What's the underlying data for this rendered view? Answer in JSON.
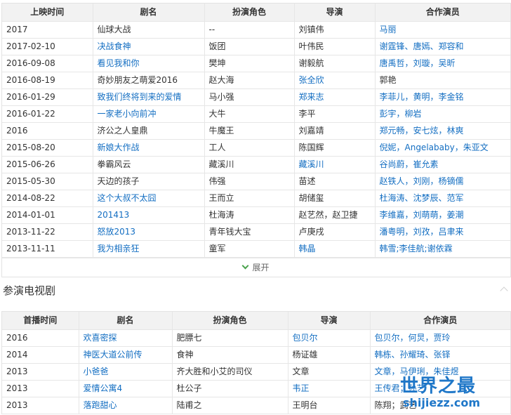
{
  "films": {
    "headers": [
      "上映时间",
      "剧名",
      "扮演角色",
      "导演",
      "合作演员"
    ],
    "rows": [
      {
        "date": "2017",
        "title": {
          "text": "仙球大战",
          "link": false
        },
        "role": "--",
        "director": {
          "text": "刘镇伟",
          "link": false
        },
        "costars": {
          "text": "马丽",
          "link": true
        }
      },
      {
        "date": "2017-02-10",
        "title": {
          "text": "决战食神",
          "link": true
        },
        "role": "饭团",
        "director": {
          "text": "叶伟民",
          "link": false
        },
        "costars": {
          "text": "谢霆锋、唐嫣、郑容和",
          "link": true
        }
      },
      {
        "date": "2016-09-08",
        "title": {
          "text": "看见我和你",
          "link": true
        },
        "role": "樊坤",
        "director": {
          "text": "谢毅航",
          "link": false
        },
        "costars": {
          "text": "唐禹哲，刘璇，吴昕",
          "link": true
        }
      },
      {
        "date": "2016-08-19",
        "title": {
          "text": "奇妙朋友之萌爱2016",
          "link": false
        },
        "role": "赵大海",
        "director": {
          "text": "张全欣",
          "link": true
        },
        "costars": {
          "text": "郭艳",
          "link": false
        }
      },
      {
        "date": "2016-01-29",
        "title": {
          "text": "致我们终将到来的爱情",
          "link": true
        },
        "role": "马小强",
        "director": {
          "text": "郑来志",
          "link": true
        },
        "costars": {
          "text": "李菲儿，黄明，李金铭",
          "link": true
        }
      },
      {
        "date": "2016-01-22",
        "title": {
          "text": "一家老小向前冲",
          "link": true
        },
        "role": "大牛",
        "director": {
          "text": "李平",
          "link": false
        },
        "costars": {
          "text": "彭宇，柳岩",
          "link": true
        }
      },
      {
        "date": "2016",
        "title": {
          "text": "济公之人皇鼎",
          "link": false
        },
        "role": "牛魔王",
        "director": {
          "text": "刘嘉靖",
          "link": false
        },
        "costars": {
          "text": "郑元畅，安七炫，林爽",
          "link": true
        }
      },
      {
        "date": "2015-08-20",
        "title": {
          "text": "新娘大作战",
          "link": true
        },
        "role": "工人",
        "director": {
          "text": "陈国辉",
          "link": false
        },
        "costars": {
          "text": "倪妮，Angelababy，朱亚文",
          "link": true
        }
      },
      {
        "date": "2015-06-26",
        "title": {
          "text": "拳霸风云",
          "link": false
        },
        "role": "藏溪川",
        "director": {
          "text": "藏溪川",
          "link": true
        },
        "costars": {
          "text": "谷尚蔚，崔允素",
          "link": true
        }
      },
      {
        "date": "2015-05-30",
        "title": {
          "text": "天边的孩子",
          "link": false
        },
        "role": "伟强",
        "director": {
          "text": "苗述",
          "link": false
        },
        "costars": {
          "text": "赵铁人，刘刚，杨镝儒",
          "link": true
        }
      },
      {
        "date": "2014-08-22",
        "title": {
          "text": "这个大叔不太囧",
          "link": true
        },
        "role": "王而立",
        "director": {
          "text": "胡储玺",
          "link": false
        },
        "costars": {
          "text": "杜海涛、沈梦辰、范军",
          "link": true
        }
      },
      {
        "date": "2014-01-01",
        "title": {
          "text": "201413",
          "link": true
        },
        "role": "杜海涛",
        "director": {
          "text": "赵艺然，赵卫捷",
          "link": false
        },
        "costars": {
          "text": "李维嘉，刘萌萌，姜潮",
          "link": true
        }
      },
      {
        "date": "2013-11-22",
        "title": {
          "text": "怒放2013",
          "link": true
        },
        "role": "青年钱大宝",
        "director": {
          "text": "卢庚戌",
          "link": false
        },
        "costars": {
          "text": "潘粤明，刘孜，吕聿来",
          "link": true
        }
      },
      {
        "date": "2013-11-11",
        "title": {
          "text": "我为相亲狂",
          "link": true
        },
        "role": "童军",
        "director": {
          "text": "韩晶",
          "link": true
        },
        "costars": {
          "text": "韩雪;李佳航;谢依霖",
          "link": true
        }
      }
    ],
    "expand_label": "展开"
  },
  "tv": {
    "section_title": "参演电视剧",
    "headers": [
      "首播时间",
      "剧名",
      "扮演角色",
      "导演",
      "合作演员"
    ],
    "rows": [
      {
        "date": "2016",
        "title": {
          "text": "欢喜密探",
          "link": true
        },
        "role": "肥膘七",
        "director": {
          "text": "包贝尔",
          "link": true
        },
        "costars": {
          "text": "包贝尔，何炅，贾玲",
          "link": true
        }
      },
      {
        "date": "2014",
        "title": {
          "text": "神医大道公前传",
          "link": true
        },
        "role": "食神",
        "director": {
          "text": "杨证雄",
          "link": false
        },
        "costars": {
          "text": "韩栋、孙耀琦、张铎",
          "link": true
        }
      },
      {
        "date": "2013",
        "title": {
          "text": "小爸爸",
          "link": true
        },
        "role": "齐大胜和小艾的司仪",
        "director": {
          "text": "文章",
          "link": false
        },
        "costars": {
          "text": "文章，马伊琍，朱佳煜",
          "link": true
        }
      },
      {
        "date": "2013",
        "title": {
          "text": "爱情公寓4",
          "link": true
        },
        "role": "杜公子",
        "director": {
          "text": "韦正",
          "link": true
        },
        "costars": {
          "text": "王传君；孙艺",
          "link": true
        }
      },
      {
        "date": "2013",
        "title": {
          "text": "落跑甜心",
          "link": true
        },
        "role": "陆甫之",
        "director": {
          "text": "王明台",
          "link": false
        },
        "costars": {
          "text": "陈翔；武艺",
          "link": false
        }
      }
    ]
  },
  "watermark": {
    "title": "世界之最",
    "url": "shijiezz.com"
  },
  "colors": {
    "link": "#136ec2",
    "header_bg": "#f2f2f2",
    "border": "#e6e6e6",
    "expand_chevron": "#49a24c"
  },
  "icons": {
    "expand": "chevron-down-icon",
    "collapse": "chevron-up-icon"
  }
}
